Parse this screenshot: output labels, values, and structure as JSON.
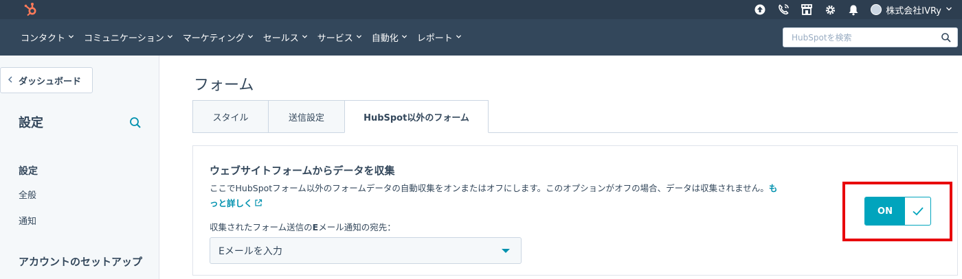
{
  "topbar": {
    "account_name": "株式会社IVRy",
    "icons": [
      "upgrade-icon",
      "phone-icon",
      "marketplace-icon",
      "settings-gear-icon",
      "notification-bell-icon"
    ]
  },
  "nav": {
    "items": [
      {
        "label": "コンタクト"
      },
      {
        "label": "コミュニケーション"
      },
      {
        "label": "マーケティング"
      },
      {
        "label": "セールス"
      },
      {
        "label": "サービス"
      },
      {
        "label": "自動化"
      },
      {
        "label": "レポート"
      }
    ],
    "search_placeholder": "HubSpotを検索"
  },
  "sidebar": {
    "back_label": "ダッシュボード",
    "title": "設定",
    "section_title": "設定",
    "links": [
      {
        "label": "全般"
      },
      {
        "label": "通知"
      }
    ],
    "section2_title": "アカウントのセットアップ"
  },
  "main": {
    "page_title": "フォーム",
    "tabs": [
      {
        "label": "スタイル",
        "active": false
      },
      {
        "label": "送信設定",
        "active": false
      },
      {
        "label": "HubSpot以外のフォーム",
        "active": true
      }
    ],
    "card": {
      "title": "ウェブサイトフォームからデータを収集",
      "description": "ここでHubSpotフォーム以外のフォームデータの自動収集をオンまたはオフにします。このオプションがオフの場合、データは収集されません。",
      "more_link_part1": "も",
      "more_link_part2": "っと詳しく",
      "field_label_pre": "収集されたフォーム送信の",
      "field_label_bold": "E",
      "field_label_post": "メール通知の宛先：",
      "select_value": "Eメールを入力",
      "toggle_label": "ON",
      "toggle_state": true
    }
  },
  "colors": {
    "topbar": "#2d3e50",
    "navbar": "#33475b",
    "accent": "#00a4bd",
    "link": "#0091ae",
    "highlight": "#e8000b",
    "logo": "#ff7a59"
  }
}
